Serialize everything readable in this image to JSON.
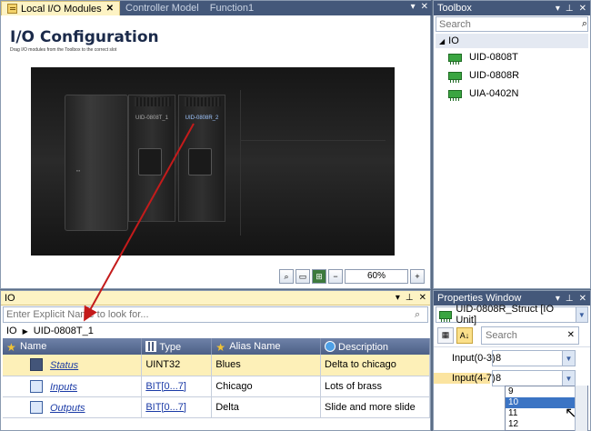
{
  "doc_tabs": [
    {
      "label": "Local I/O Modules",
      "active": true
    },
    {
      "label": "Controller Model",
      "active": false
    },
    {
      "label": "Function1",
      "active": false
    }
  ],
  "doc_controls": {
    "dropdown": "▾",
    "close": "✕"
  },
  "io_config": {
    "title": "I/O Configuration",
    "subtitle": "Drag I/O modules from the Toolbox to the correct slot",
    "modules": [
      {
        "label": "UID-0808T_1",
        "selected": false
      },
      {
        "label": "UID-0808R_2",
        "selected": true
      }
    ],
    "zoom": "60%"
  },
  "io_pane": {
    "title": "IO",
    "search_placeholder": "Enter Explicit Name to look for...",
    "breadcrumb": [
      "IO",
      "UID-0808T_1"
    ],
    "columns": [
      "Name",
      "Type",
      "Alias Name",
      "Description"
    ],
    "rows": [
      {
        "name": "Status",
        "type": "UINT32",
        "alias": "Blues",
        "description": "Delta to chicago",
        "selected": true
      },
      {
        "name": "Inputs",
        "type": "BIT[0...7]",
        "alias": "Chicago",
        "description": "Lots of brass",
        "selected": false
      },
      {
        "name": "Outputs",
        "type": "BIT[0...7]",
        "alias": "Delta",
        "description": "Slide and more slide",
        "selected": false
      }
    ]
  },
  "toolbox": {
    "title": "Toolbox",
    "search_placeholder": "Search",
    "group": "IO",
    "items": [
      "UID-0808T",
      "UID-0808R",
      "UIA-0402N"
    ]
  },
  "properties": {
    "title": "Properties Window",
    "object": "UID-0808R_Struct [IO Unit]",
    "search_placeholder": "Search",
    "rows": [
      {
        "key": "Input(0-3)",
        "value": "8"
      },
      {
        "key": "Input(4-7)",
        "value": "8"
      }
    ],
    "dropdown_options": [
      "9",
      "10",
      "11",
      "12"
    ],
    "highlighted_option": "10"
  },
  "colors": {
    "accent": "#44587a",
    "selection": "#fdf0b8",
    "arrow": "#c41b1b"
  }
}
